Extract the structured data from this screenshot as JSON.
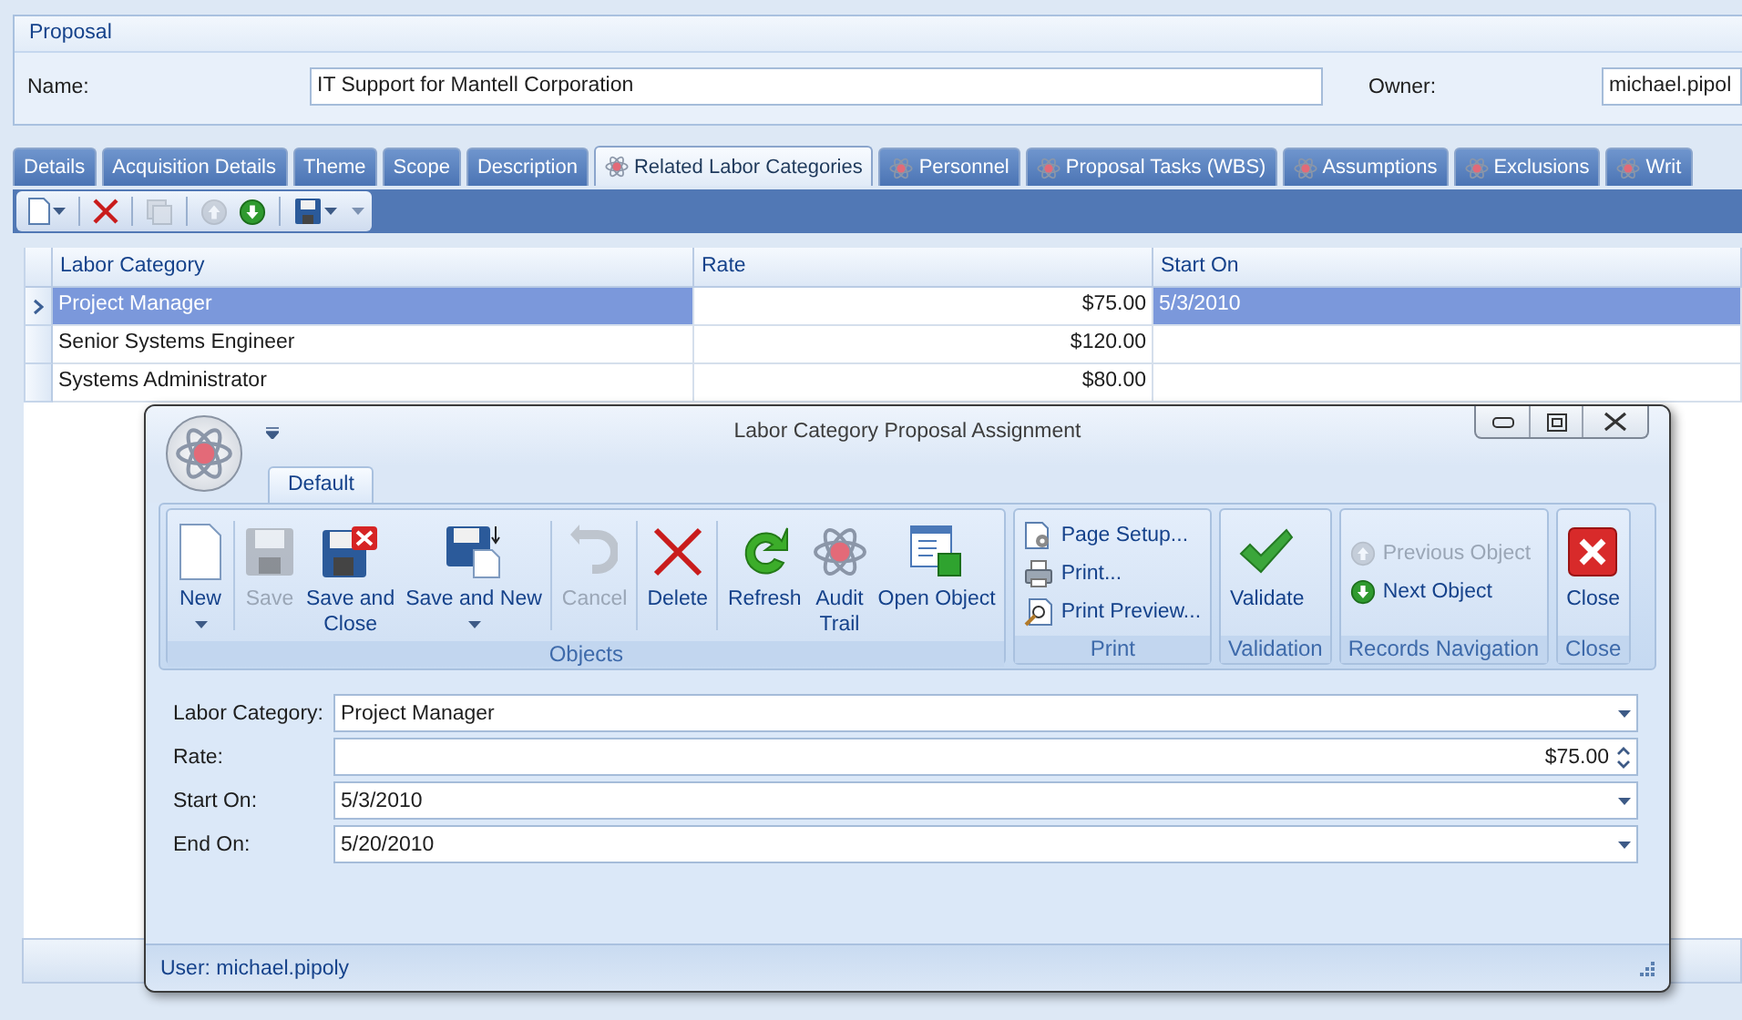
{
  "proposal": {
    "title": "Proposal",
    "fields": [
      {
        "kind": "name",
        "label": "Name:",
        "value": "IT Support for Mantell Corporation"
      },
      {
        "kind": "owner",
        "label": "Owner:",
        "value": "michael.pipol"
      }
    ]
  },
  "tabs": [
    {
      "label": "Details",
      "selected": false,
      "icon": false
    },
    {
      "label": "Acquisition Details",
      "selected": false,
      "icon": false
    },
    {
      "label": "Theme",
      "selected": false,
      "icon": false
    },
    {
      "label": "Scope",
      "selected": false,
      "icon": false
    },
    {
      "label": "Description",
      "selected": false,
      "icon": false
    },
    {
      "label": "Related Labor Categories",
      "selected": true,
      "icon": true
    },
    {
      "label": "Personnel",
      "selected": false,
      "icon": true
    },
    {
      "label": "Proposal Tasks (WBS)",
      "selected": false,
      "icon": true
    },
    {
      "label": "Assumptions",
      "selected": false,
      "icon": true
    },
    {
      "label": "Exclusions",
      "selected": false,
      "icon": true
    },
    {
      "label": "Writ",
      "selected": false,
      "icon": true
    }
  ],
  "toolbar": {
    "groups": [
      {
        "items": [
          {
            "kind": "new",
            "disabled": false,
            "dropdown": true
          }
        ]
      },
      {
        "items": [
          {
            "kind": "delete",
            "disabled": false,
            "dropdown": false
          }
        ]
      },
      {
        "items": [
          {
            "kind": "copy",
            "disabled": true,
            "dropdown": false
          }
        ]
      },
      {
        "items": [
          {
            "kind": "previous",
            "disabled": true,
            "dropdown": false
          },
          {
            "kind": "next",
            "disabled": false,
            "dropdown": false
          }
        ]
      },
      {
        "items": [
          {
            "kind": "save",
            "disabled": false,
            "dropdown": true
          }
        ]
      }
    ]
  },
  "grid": {
    "columns": [
      {
        "label": "Labor Category",
        "kind": "text"
      },
      {
        "label": "Rate",
        "kind": "money"
      },
      {
        "label": "Start On",
        "kind": "date"
      }
    ],
    "rows": [
      {
        "selected": true,
        "cells": [
          {
            "text": "Project Manager",
            "highlighted": true
          },
          {
            "text": "$75.00",
            "highlighted": false
          },
          {
            "text": "5/3/2010",
            "highlighted": true
          }
        ]
      },
      {
        "selected": false,
        "cells": [
          {
            "text": "Senior Systems Engineer",
            "highlighted": false
          },
          {
            "text": "$120.00",
            "highlighted": false
          }
        ]
      },
      {
        "selected": false,
        "cells": [
          {
            "text": "Systems Administrator",
            "highlighted": false
          },
          {
            "text": "$80.00",
            "highlighted": false
          }
        ]
      }
    ]
  },
  "dialog": {
    "title": "Labor Category Proposal Assignment",
    "ribbon_tab": {
      "label": "Default",
      "selected": true
    },
    "groups": [
      {
        "label": "Objects",
        "sections": [
          [
            {
              "kind": "new",
              "label": "New",
              "disabled": false,
              "dropdown": true
            }
          ],
          [
            {
              "kind": "save",
              "label": "Save",
              "disabled": true,
              "dropdown": false
            },
            {
              "kind": "save_close",
              "label": "Save and\nClose",
              "disabled": false,
              "dropdown": false
            },
            {
              "kind": "save_new",
              "label": "Save and New",
              "disabled": false,
              "dropdown": true
            }
          ],
          [
            {
              "kind": "cancel",
              "label": "Cancel",
              "disabled": true,
              "dropdown": false
            }
          ],
          [
            {
              "kind": "delete",
              "label": "Delete",
              "disabled": false,
              "dropdown": false
            }
          ],
          [
            {
              "kind": "refresh",
              "label": "Refresh",
              "disabled": false,
              "dropdown": false
            },
            {
              "kind": "audit",
              "label": "Audit\nTrail",
              "disabled": false,
              "dropdown": false
            },
            {
              "kind": "open",
              "label": "Open Object",
              "disabled": false,
              "dropdown": false
            }
          ]
        ]
      },
      {
        "label": "Print",
        "sections": [
          [
            {
              "kind": "page_setup",
              "label": "Page Setup...",
              "disabled": false
            },
            {
              "kind": "print",
              "label": "Print...",
              "disabled": false
            },
            {
              "kind": "preview",
              "label": "Print Preview...",
              "disabled": false
            }
          ]
        ]
      },
      {
        "label": "Validation",
        "sections": [
          [
            {
              "kind": "validate",
              "label": "Validate",
              "disabled": false,
              "dropdown": false
            }
          ]
        ]
      },
      {
        "label": "Records Navigation",
        "sections": [
          [
            {
              "kind": "previous",
              "label": "Previous Object",
              "disabled": true
            },
            {
              "kind": "next",
              "label": "Next Object",
              "disabled": false
            }
          ]
        ]
      },
      {
        "label": "Close",
        "sections": [
          [
            {
              "kind": "close",
              "label": "Close",
              "disabled": false,
              "dropdown": false
            }
          ]
        ]
      }
    ],
    "fields": [
      {
        "label": "Labor Category:",
        "value": "Project Manager",
        "kind": "dropdown"
      },
      {
        "label": "Rate:",
        "value": "$75.00",
        "kind": "spin"
      },
      {
        "label": "Start On:",
        "value": "5/3/2010",
        "kind": "dropdown"
      },
      {
        "label": "End On:",
        "value": "5/20/2010",
        "kind": "dropdown"
      }
    ],
    "status": "User: michael.pipoly"
  }
}
